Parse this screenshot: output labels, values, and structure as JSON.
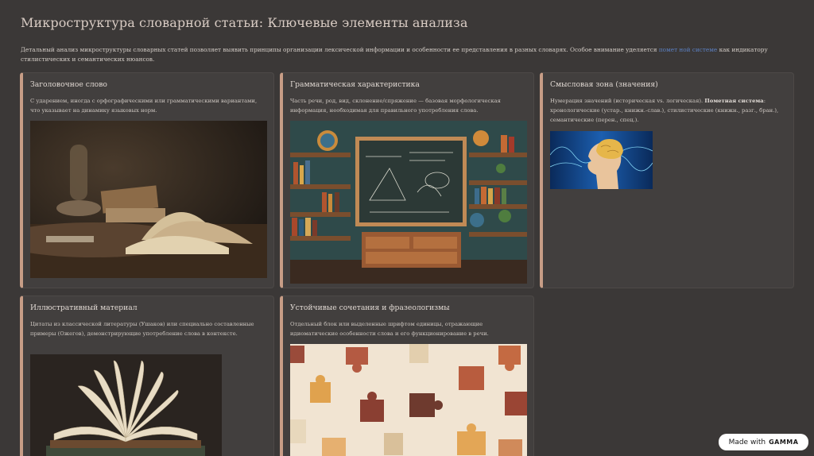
{
  "page": {
    "title": "Микроструктура словарной статьи: Ключевые элементы анализа",
    "intro_before": "Детальный анализ микроструктуры словарных статей позволяет выявить принципы организации лексической информации и особенности ее представления в разных словарях. Особое внимание уделяется ",
    "intro_highlight": "помет ной системе",
    "intro_after": " как индикатору стилистических и семантических нюансов."
  },
  "cards": [
    {
      "title": "Заголовочное слово",
      "text": "С ударением, иногда с орфографическими или грамматическими вариантами, что указывает на динамику языковых норм.",
      "image": "antique-books-with-oil-lamp-photo"
    },
    {
      "title": "Грамматическая характеристика",
      "text": "Часть речи, род, вид, склонение/спряжение — базовая морфологическая информация, необходимая для правильного употребления слова.",
      "image": "classroom-chalkboard-bookshelves-photo"
    },
    {
      "title": "Смысловая зона (значения)",
      "text_before": "Нумерация значений (историческая vs. логическая). ",
      "text_bold": "Пометная система",
      "text_after": ": хронологические (устар., книжн.-слав.), стилистические (книжн., разг., бран.), семантические (перен., спец.).",
      "image": "glowing-brain-head-illustration"
    },
    {
      "title": "Иллюстративный материал",
      "text": "Цитаты из классической литературы (Ушаков) или специально составленные примеры (Ожегов), демонстрирующие употребление слова в контексте.",
      "image": "open-book-fanned-pages-photo"
    },
    {
      "title": "Устойчивые сочетания и фразеологизмы",
      "text": "Отдельный блок или выделенные шрифтом единицы, отражающие идиоматические особенности слова и его функционирование в речи.",
      "image": "puzzle-pieces-pattern-illustration"
    }
  ],
  "badge": {
    "prefix": "Made with",
    "brand": "GAMMA"
  }
}
